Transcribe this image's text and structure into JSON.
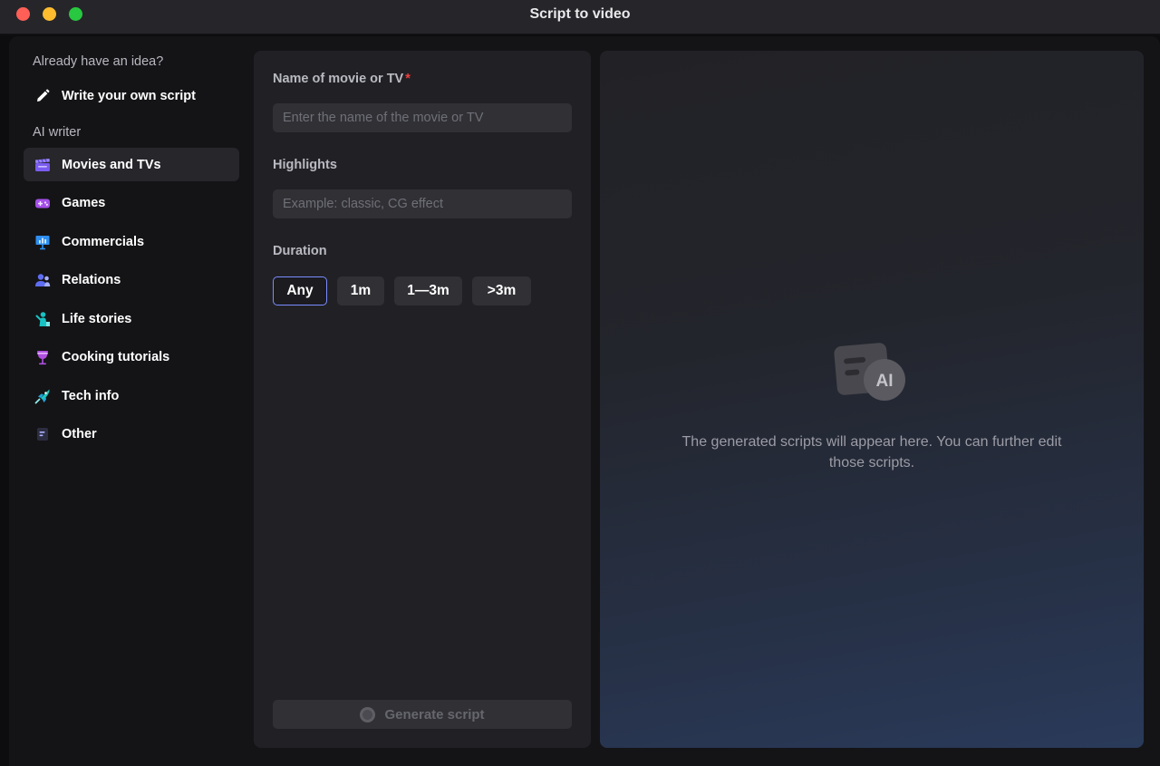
{
  "window": {
    "title": "Script to video"
  },
  "sidebar": {
    "idea_label": "Already have an idea?",
    "write_own": {
      "label": "Write your own script",
      "icon": "pencil-icon"
    },
    "ai_writer_label": "AI writer",
    "items": [
      {
        "label": "Movies and TVs",
        "icon": "clapperboard-icon",
        "active": true
      },
      {
        "label": "Games",
        "icon": "gamepad-icon"
      },
      {
        "label": "Commercials",
        "icon": "presentation-icon"
      },
      {
        "label": "Relations",
        "icon": "people-icon"
      },
      {
        "label": "Life stories",
        "icon": "person-icon"
      },
      {
        "label": "Cooking tutorials",
        "icon": "wine-glass-icon"
      },
      {
        "label": "Tech info",
        "icon": "rocket-icon"
      },
      {
        "label": "Other",
        "icon": "document-icon"
      }
    ]
  },
  "form": {
    "name_label": "Name of movie or TV",
    "required_mark": "*",
    "name_placeholder": "Enter the name of the movie or TV",
    "name_value": "",
    "highlights_label": "Highlights",
    "highlights_placeholder": "Example: classic, CG effect",
    "highlights_value": "",
    "duration_label": "Duration",
    "duration_options": [
      "Any",
      "1m",
      "1—3m",
      ">3m"
    ],
    "duration_selected": "Any",
    "generate_label": "Generate script"
  },
  "preview": {
    "empty_message": "The generated scripts will appear here. You can further edit those scripts.",
    "badge_text": "AI"
  },
  "colors": {
    "accent_border": "#7a8cff",
    "required": "#f03d3d",
    "close": "#ff5f57",
    "minimize": "#febc2e",
    "maximize": "#28c840"
  }
}
